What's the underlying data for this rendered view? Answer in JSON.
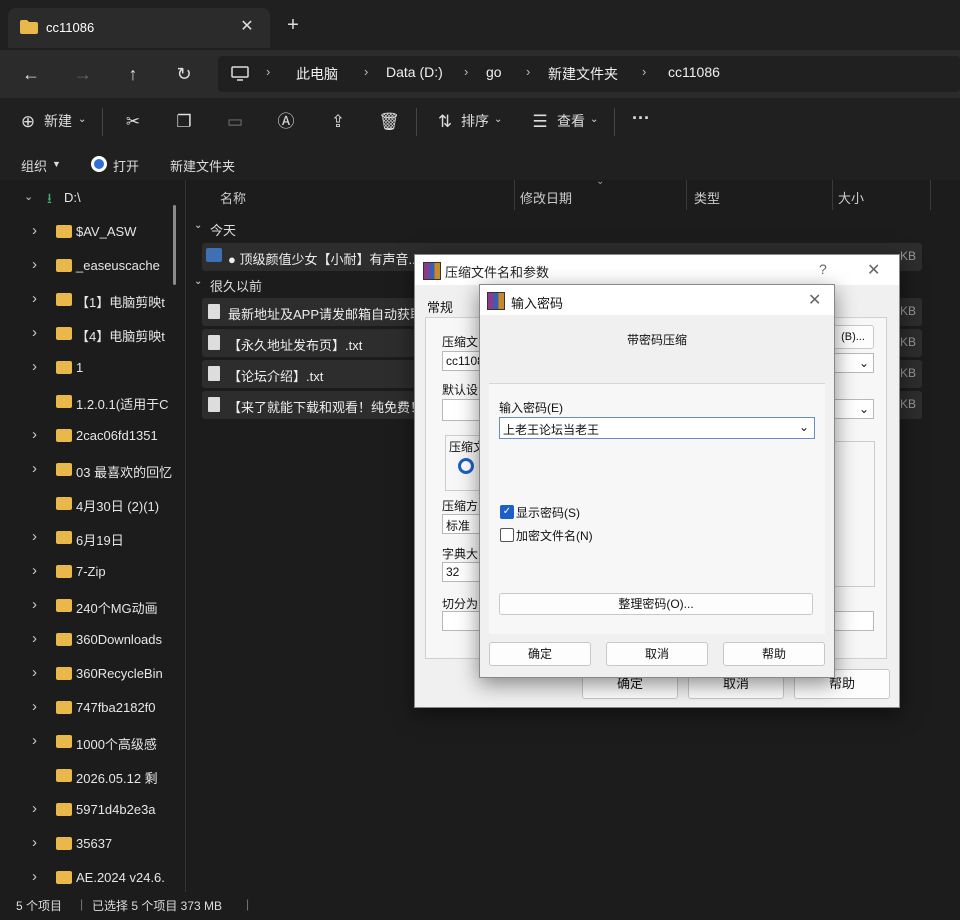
{
  "tab": {
    "title": "cc11086",
    "close": "✕",
    "new": "+"
  },
  "nav": {
    "back": "←",
    "forward": "→",
    "up": "↑",
    "refresh": "↻",
    "breadcrumb": [
      "此电脑",
      "Data (D:)",
      "go",
      "新建文件夹",
      "cc11086"
    ]
  },
  "commands": {
    "new": "新建",
    "sort": "排序",
    "view": "查看",
    "more": "···"
  },
  "toolbar2": {
    "organize": "组织",
    "open": "打开",
    "new_folder": "新建文件夹"
  },
  "sidebar": {
    "root": "D:\\",
    "items": [
      {
        "label": "$AV_ASW",
        "arrow": true
      },
      {
        "label": "_easeuscache",
        "arrow": true
      },
      {
        "label": "【1】电脑剪映t",
        "arrow": true
      },
      {
        "label": "【4】电脑剪映t",
        "arrow": true
      },
      {
        "label": "1",
        "arrow": true
      },
      {
        "label": "1.2.0.1(适用于C",
        "arrow": false
      },
      {
        "label": "2cac06fd1351",
        "arrow": true
      },
      {
        "label": "03 最喜欢的回忆",
        "arrow": true
      },
      {
        "label": "4月30日 (2)(1)",
        "arrow": false
      },
      {
        "label": "6月19日",
        "arrow": true
      },
      {
        "label": "7-Zip",
        "arrow": true
      },
      {
        "label": "240个MG动画",
        "arrow": true
      },
      {
        "label": "360Downloads",
        "arrow": true
      },
      {
        "label": "360RecycleBin",
        "arrow": true
      },
      {
        "label": "747fba2182f0",
        "arrow": true
      },
      {
        "label": "1000个高级感",
        "arrow": true
      },
      {
        "label": "2026.05.12 剩",
        "arrow": false
      },
      {
        "label": "5971d4b2e3a",
        "arrow": true
      },
      {
        "label": "35637",
        "arrow": true
      },
      {
        "label": "AE.2024 v24.6.",
        "arrow": true
      }
    ]
  },
  "columns": {
    "name": "名称",
    "modified": "修改日期",
    "type": "类型",
    "size": "大小"
  },
  "groups": {
    "today": "今天",
    "long_ago": "很久以前"
  },
  "files_today": [
    {
      "name": "● 顶级颜值少女【小耐】有声音...",
      "size": "KB"
    }
  ],
  "files_old": [
    {
      "name": "最新地址及APP请发邮箱自动获取",
      "size": "KB"
    },
    {
      "name": "【永久地址发布页】.txt",
      "size": "KB"
    },
    {
      "name": "【论坛介绍】.txt",
      "size": "KB"
    },
    {
      "name": "【来了就能下载和观看！纯免费！",
      "size": "KB"
    }
  ],
  "status": {
    "count": "5 个项目",
    "selected": "已选择 5 个项目 373 MB"
  },
  "dialog_archive": {
    "title": "压缩文件名和参数",
    "tab": "常规",
    "label_name": "压缩文",
    "name_value": "cc1108",
    "browse": "(B)...",
    "label_default": "默认设",
    "label_format": "压缩文",
    "label_method": "压缩方",
    "method_value": "标准",
    "label_dict": "字典大",
    "dict_value": "32",
    "label_split": "切分为",
    "ok": "确定",
    "cancel": "取消",
    "help": "帮助"
  },
  "dialog_password": {
    "title": "输入密码",
    "subtitle": "带密码压缩",
    "label": "输入密码(E)",
    "value": "上老王论坛当老王",
    "show_password": "显示密码(S)",
    "encrypt_names": "加密文件名(N)",
    "organize": "整理密码(O)...",
    "ok": "确定",
    "cancel": "取消",
    "help": "帮助"
  }
}
